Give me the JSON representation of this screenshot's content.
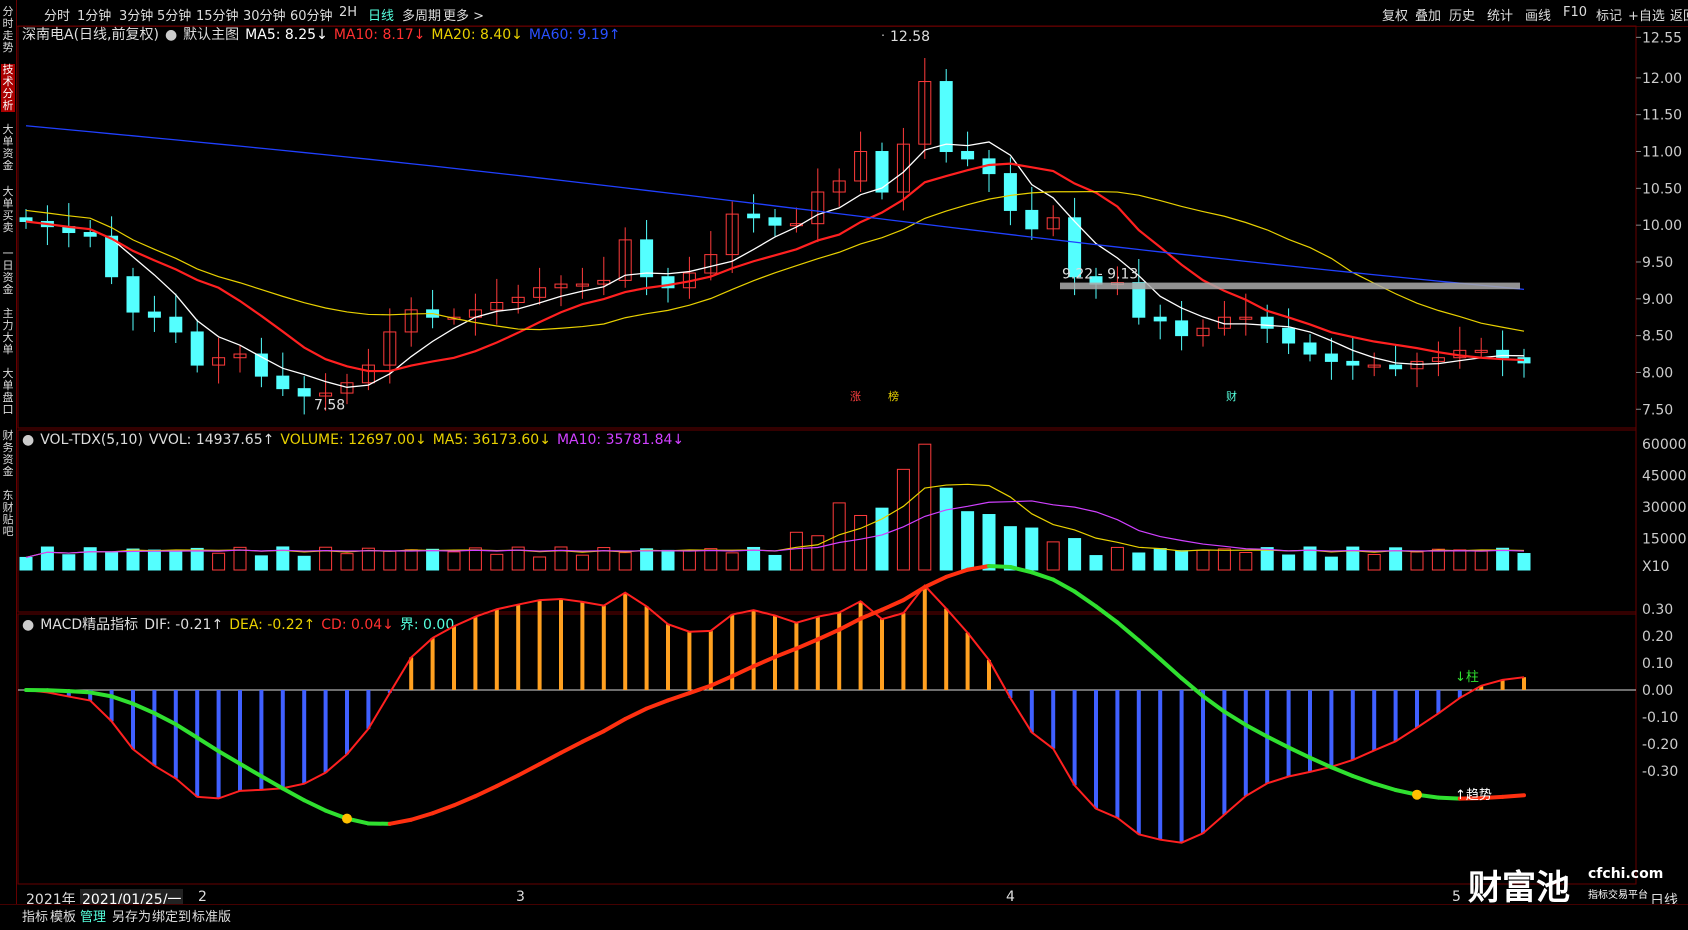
{
  "top_tabs": [
    "分时",
    "1分钟",
    "3分钟",
    "5分钟",
    "15分钟",
    "30分钟",
    "60分钟",
    "2H",
    "日线",
    "多周期",
    "更多 >"
  ],
  "top_active": "日线",
  "top_right": [
    "复权",
    "叠加",
    "历史",
    "统计",
    "画线",
    "F10",
    "标记",
    "+自选",
    "返回"
  ],
  "sidebar": [
    "分时走势",
    "技术分析",
    "大单资金",
    "大单买卖",
    "一日资金",
    "主力大单",
    "大单盘口",
    "财务资金",
    "东财贴吧"
  ],
  "sidebar_active": "技术分析",
  "main_legend": {
    "stock": "深南电A(日线,前复权)",
    "template": "默认主图",
    "ma5": "MA5: 8.25↓",
    "ma10": "MA10: 8.17↓",
    "ma20": "MA20: 8.40↓",
    "ma60": "MA60: 9.19↑"
  },
  "vol_legend": {
    "name": "VOL-TDX(5,10)",
    "vvol": "VVOL: 14937.65↑",
    "volume": "VOLUME: 12697.00↓",
    "ma5": "MA5: 36173.60↓",
    "ma10": "MA10: 35781.84↓"
  },
  "macd_legend": {
    "name": "MACD精品指标",
    "dif": "DIF: -0.21↑",
    "dea": "DEA: -0.22↑",
    "cd": "CD: 0.04↓",
    "jie": "界: 0.00"
  },
  "price_axis": [
    "12.55",
    "12.00",
    "11.50",
    "11.00",
    "10.50",
    "10.00",
    "9.50",
    "9.00",
    "8.50",
    "8.00",
    "7.50"
  ],
  "vol_axis": [
    "60000",
    "45000",
    "30000",
    "15000",
    "X10"
  ],
  "macd_axis": [
    "0.30",
    "0.20",
    "0.10",
    "0.00",
    "-0.10",
    "-0.20",
    "-0.30"
  ],
  "annotations": {
    "high": "12.58",
    "low": "7.58",
    "range": "9.22 - 9.13",
    "zhang": "涨",
    "bang": "榜",
    "cai": "财",
    "zhu": "↓柱",
    "qushi": "↑趋势"
  },
  "x_labels": {
    "year": "2021年",
    "date": "2021/01/25/一",
    "m2": "2",
    "m3": "3",
    "m4": "4",
    "m5": "5",
    "period": "日线"
  },
  "bottom_tabs": [
    "指标",
    "模板",
    "管理",
    "另存为",
    "绑定到",
    "标准版"
  ],
  "watermark": {
    "brand": "财富池",
    "site": "cfchi.com",
    "slogan": "指标交易平台"
  },
  "colors": {
    "up": "#ff3b3b",
    "down": "#54ffff",
    "ma5": "#ffffff",
    "ma10": "#ff2020",
    "ma20": "#e8d000",
    "ma60": "#2040ff",
    "vma10": "#d040ff"
  },
  "chart_data": {
    "type": "candlestick",
    "closes": [
      10.05,
      9.98,
      9.9,
      9.85,
      9.3,
      8.82,
      8.75,
      8.55,
      8.1,
      8.2,
      8.25,
      7.95,
      7.78,
      7.68,
      7.72,
      7.86,
      8.1,
      8.55,
      8.85,
      8.75,
      8.75,
      8.85,
      8.95,
      9.02,
      9.15,
      9.2,
      9.2,
      9.25,
      9.8,
      9.3,
      9.15,
      9.35,
      9.6,
      10.15,
      10.1,
      10.0,
      10.02,
      10.45,
      10.6,
      11.0,
      10.45,
      11.1,
      11.95,
      11.0,
      10.9,
      10.7,
      10.2,
      9.95,
      10.1,
      9.3,
      9.2,
      9.22,
      8.75,
      8.7,
      8.5,
      8.6,
      8.75,
      8.75,
      8.6,
      8.4,
      8.25,
      8.15,
      8.1,
      8.1,
      8.05,
      8.15,
      8.2,
      8.3,
      8.3,
      8.2,
      8.13
    ],
    "ma_bounds": {
      "ylim": [
        7.3,
        12.65
      ]
    },
    "high": 12.58,
    "low": 7.58
  }
}
